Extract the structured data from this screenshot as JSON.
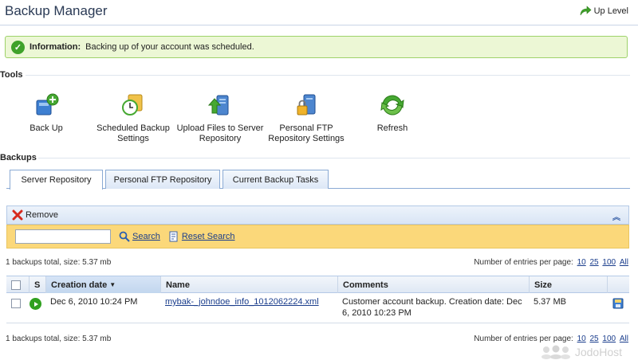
{
  "header": {
    "title": "Backup Manager",
    "up_level": "Up Level"
  },
  "info": {
    "label": "Information:",
    "message": "Backing up of your account was scheduled."
  },
  "tools": {
    "section_title": "Tools",
    "items": [
      {
        "label": "Back Up",
        "icon": "backup-icon"
      },
      {
        "label": "Scheduled Backup Settings",
        "icon": "scheduled-backup-icon"
      },
      {
        "label": "Upload Files to Server Repository",
        "icon": "upload-icon"
      },
      {
        "label": "Personal FTP Repository Settings",
        "icon": "ftp-settings-icon"
      },
      {
        "label": "Refresh",
        "icon": "refresh-icon"
      }
    ]
  },
  "backups": {
    "section_title": "Backups",
    "tabs": [
      {
        "label": "Server Repository",
        "active": true
      },
      {
        "label": "Personal FTP Repository",
        "active": false
      },
      {
        "label": "Current Backup Tasks",
        "active": false
      }
    ],
    "remove_label": "Remove",
    "search": {
      "value": "",
      "search_label": "Search",
      "reset_label": "Reset Search"
    },
    "summary": "1 backups total, size: 5.37 mb",
    "per_page": {
      "label": "Number of entries per page:",
      "options": [
        "10",
        "25",
        "100",
        "All"
      ]
    },
    "columns": {
      "status": "S",
      "date": "Creation date",
      "name": "Name",
      "comments": "Comments",
      "size": "Size"
    },
    "rows": [
      {
        "date": "Dec 6, 2010 10:24 PM",
        "name": "mybak-_johndoe_info_1012062224.xml",
        "comments": "Customer account backup. Creation date: Dec 6, 2010 10:23 PM",
        "size": "5.37 MB"
      }
    ]
  },
  "watermark": "JodoHost",
  "colors": {
    "info_bg": "#ecf7d5",
    "search_bar": "#fbd87a",
    "link": "#1a3d8c",
    "ok_green": "#3fa22a"
  }
}
